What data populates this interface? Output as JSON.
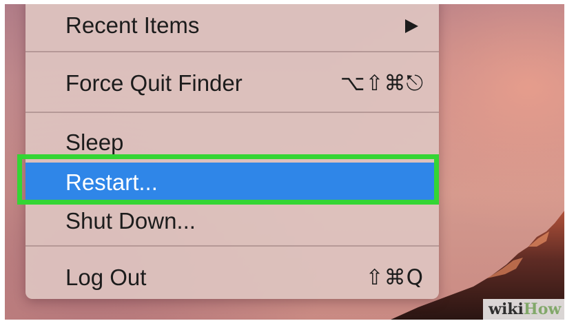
{
  "menu": {
    "items": [
      {
        "label": "Recent Items",
        "submenu_icon": "triangle-right-icon"
      },
      {
        "label": "Force Quit Finder",
        "shortcut": "⌥⇧⌘⎋"
      },
      {
        "label": "Sleep"
      },
      {
        "label": "Restart...",
        "highlighted": true
      },
      {
        "label": "Shut Down..."
      },
      {
        "label": "Log Out",
        "shortcut": "⇧⌘Q"
      }
    ]
  },
  "annotation": {
    "highlight_color": "#34d534",
    "target": "Restart..."
  },
  "selection_color": "#2f86e8",
  "watermark": {
    "part1": "wiki",
    "part2": "How"
  }
}
